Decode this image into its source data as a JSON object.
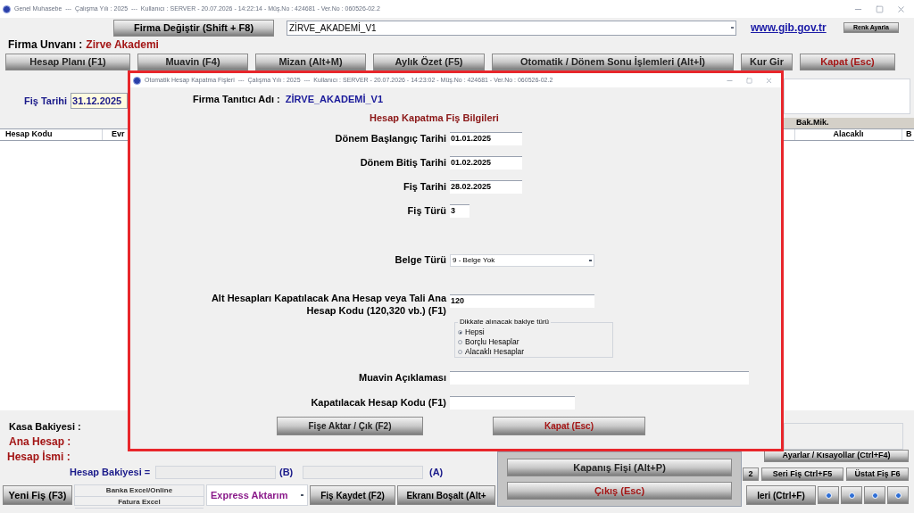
{
  "main_window": {
    "title": "Genel Muhasebe  ---  Çalışma Yılı : 2025  ---  Kullanıcı : SERVER - 20.07.2026 - 14:22:14 - Müş.No : 424681 - Ver.No : 060526-02.2",
    "firma_button": "Firma Değiştir (Shift + F8)",
    "firma_combo": "ZİRVE_AKADEMİ_V1",
    "link": "www.gib.gov.tr",
    "color_button": "Renk Ayarla",
    "firma_unvani_label": "Firma Unvanı :",
    "firma_unvani": "Zirve Akademi",
    "toolbar": [
      {
        "label": "Hesap Planı (F1)",
        "kind": "normal"
      },
      {
        "label": "Muavin (F4)",
        "kind": "normal"
      },
      {
        "label": "Mizan (Alt+M)",
        "kind": "normal"
      },
      {
        "label": "Aylık Özet (F5)",
        "kind": "normal"
      },
      {
        "label": "Otomatik / Dönem Sonu İşlemleri (Alt+İ)",
        "kind": "normal"
      },
      {
        "label": "Kur Gir",
        "kind": "normal"
      },
      {
        "label": "Kapat (Esc)",
        "kind": "danger"
      }
    ],
    "fis_tarihi_label": "Fiş Tarihi",
    "fis_tarihi": "31.12.2025",
    "bak_mik": "Bak.Mik.",
    "columns": [
      "Hesap Kodu",
      "Evr",
      "Alacaklı",
      "B"
    ],
    "kasa_label": "Kasa Bakiyesi :",
    "ana_hesap_label": "Ana Hesap :",
    "hesap_ismi_label": "Hesap İsmi :",
    "hesap_bakiyesi_label": "Hesap Bakiyesi =",
    "b_marker": "(B)",
    "a_marker": "(A)",
    "settings_button": "Ayarlar / Kısayollar (Ctrl+F4)",
    "mid_buttons": [
      "2",
      "Seri Fiş Ctrl+F5",
      "Üstat Fiş F6"
    ],
    "new_button": "Yeni Fiş (F3)",
    "excel_menu": [
      "Banka Excel/Online",
      "Fatura Excel"
    ],
    "express": "Express Aktarım",
    "bottom_buttons": [
      "Fiş Kaydet (F2)",
      "Ekranı Boşalt (Alt+"
    ],
    "right_button": "leri (Ctrl+F)"
  },
  "popup_menu": [
    {
      "label": "Kapanış Fişi (Alt+P)",
      "kind": "normal"
    },
    {
      "label": "Çıkış (Esc)",
      "kind": "danger"
    }
  ],
  "dialog": {
    "title": "Otomatik Hesap Kapatma Fişleri  ---  Çalışma Yılı : 2025  ---  Kullanıcı : SERVER - 20.07.2026 - 14:23:02 - Müş.No : 424681 - Ver.No : 060526-02.2",
    "firma_label": "Firma Tanıtıcı Adı :",
    "firma_value": "ZİRVE_AKADEMİ_V1",
    "heading": "Hesap Kapatma Fiş Bilgileri",
    "fields": [
      {
        "label": "Dönem Başlangıç Tarihi",
        "value": "01.01.2025",
        "kind": "date"
      },
      {
        "label": "Dönem Bitiş Tarihi",
        "value": "01.02.2025",
        "kind": "date"
      },
      {
        "label": "Fiş Tarihi",
        "value": "28.02.2025",
        "kind": "date"
      },
      {
        "label": "Fiş Türü",
        "value": "3",
        "kind": "short"
      },
      {
        "label": "Belge Türü",
        "value": "9 - Belge Yok",
        "kind": "select"
      }
    ],
    "account_label": "Alt Hesapları Kapatılacak Ana Hesap veya Tali Ana Hesap Kodu (120,320 vb.) (F1)",
    "account_value": "120",
    "group_legend": "Dikkate alınacak bakiye türü",
    "options": [
      {
        "label": "Hepsi",
        "selected": true
      },
      {
        "label": "Borçlu Hesaplar",
        "selected": false
      },
      {
        "label": "Alacaklı Hesaplar",
        "selected": false
      }
    ],
    "text_fields": [
      {
        "label": "Muavin Açıklaması",
        "kind": "long"
      },
      {
        "label": "Kapatılacak Hesap Kodu (F1)",
        "kind": "medium"
      }
    ],
    "buttons": [
      {
        "label": "Fişe Aktar / Çık (F2)",
        "kind": "normal"
      },
      {
        "label": "Kapat (Esc)",
        "kind": "danger"
      }
    ]
  }
}
